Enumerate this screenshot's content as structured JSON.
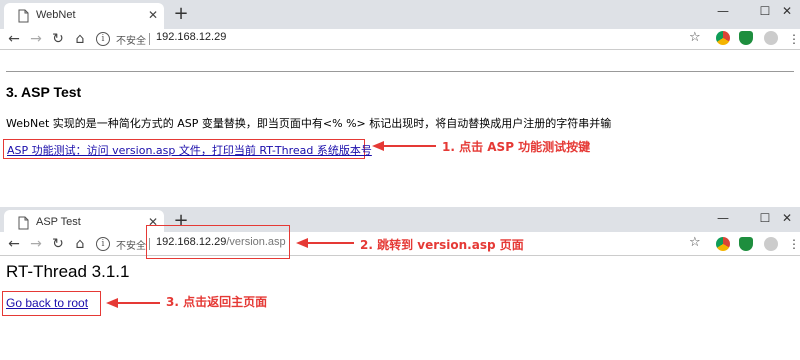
{
  "window1": {
    "tab_title": "WebNet",
    "insecure_label": "不安全",
    "url": "192.168.12.29",
    "url_path": "",
    "controls": {
      "minimize": "—",
      "maximize": "☐",
      "close": "✕"
    }
  },
  "page1": {
    "heading": "3. ASP Test",
    "description": "WebNet 实现的是一种简化方式的 ASP 变量替换，即当页面中有<% %> 标记出现时，将自动替换成用户注册的字符串并输",
    "link_text": "ASP 功能测试：访问 version.asp 文件，打印当前 RT-Thread 系统版本号"
  },
  "window2": {
    "tab_title": "ASP Test",
    "insecure_label": "不安全",
    "url": "192.168.12.29",
    "url_path": "/version.asp",
    "controls": {
      "minimize": "—",
      "maximize": "☐",
      "close": "✕"
    }
  },
  "page2": {
    "version_title": "RT-Thread 3.1.1",
    "back_link": "Go back to root"
  },
  "annotations": {
    "a1": "1. 点击 ASP 功能测试按键",
    "a2": "2. 跳转到 version.asp 页面",
    "a3": "3. 点击返回主页面"
  },
  "colors": {
    "annotation": "#e53935",
    "link": "#1a0dab",
    "tabbar": "#dee1e6"
  }
}
